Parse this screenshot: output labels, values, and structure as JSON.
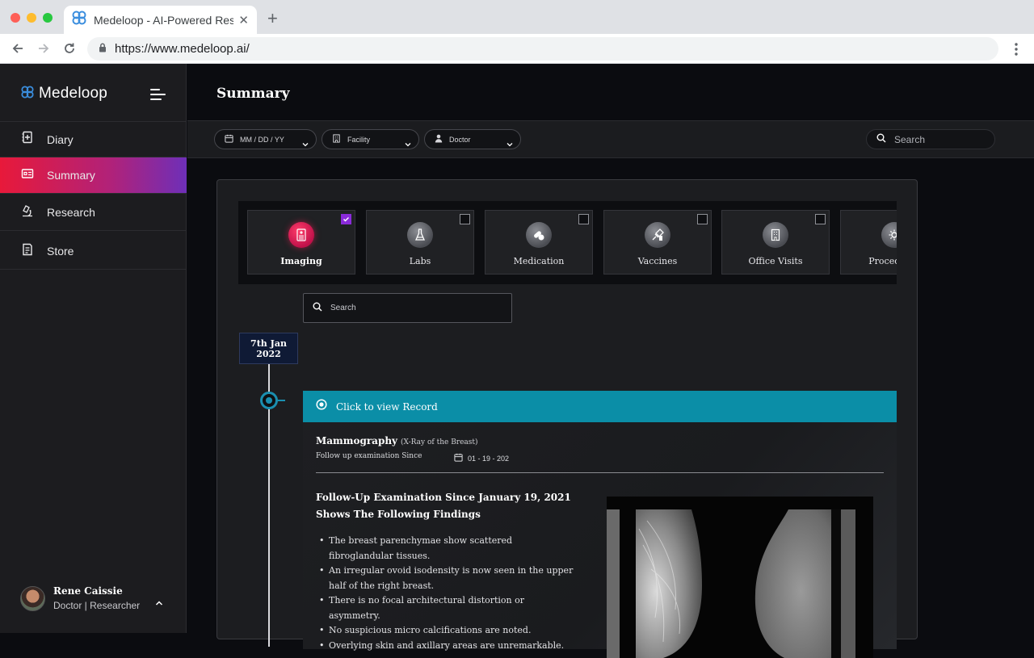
{
  "browser": {
    "tab_title": "Medeloop - AI-Powered Research",
    "url": "https://www.medeloop.ai/"
  },
  "app": {
    "logo_text": "Medeloop",
    "colors": {
      "accent_red": "#e8193a",
      "accent_purple": "#6e2fb8",
      "record_teal": "#0b8ea7",
      "checkbox_purple": "#8a2bd9"
    }
  },
  "sidebar": {
    "items": [
      {
        "label": "Diary",
        "icon": "diary-icon"
      },
      {
        "label": "Summary",
        "icon": "summary-icon",
        "active": true
      },
      {
        "label": "Research",
        "icon": "microscope-icon"
      },
      {
        "label": "Store",
        "icon": "store-icon"
      }
    ],
    "user": {
      "name": "Rene Caissie",
      "role": "Doctor | Researcher"
    }
  },
  "header": {
    "title": "Summary"
  },
  "filters": {
    "date_placeholder": "MM / DD / YY",
    "facility": "Facility",
    "doctor": "Doctor",
    "search_placeholder": "Search"
  },
  "categories": [
    {
      "label": "Imaging",
      "icon": "imaging-icon",
      "checked": true
    },
    {
      "label": "Labs",
      "icon": "flask-icon",
      "checked": false
    },
    {
      "label": "Medication",
      "icon": "pill-icon",
      "checked": false
    },
    {
      "label": "Vaccines",
      "icon": "vaccine-icon",
      "checked": false
    },
    {
      "label": "Office Visits",
      "icon": "building-icon",
      "checked": false
    },
    {
      "label": "Procedures",
      "icon": "procedures-icon",
      "checked": false
    }
  ],
  "record_search": {
    "placeholder": "Search"
  },
  "timeline": {
    "date_line1": "7th Jan",
    "date_line2": "2022"
  },
  "record": {
    "header_label": "Click to view Record",
    "exam_title": "Mammography",
    "exam_subtitle": "(X-Ray of the Breast)",
    "follow_up": "Follow up examination Since",
    "date": "01 - 19 - 202",
    "findings_heading_1": "Follow-Up Examination Since January 19, 2021",
    "findings_heading_2": "Shows The Following Findings",
    "findings": [
      "The breast parenchymae show scattered fibroglandular tissues.",
      "An irregular ovoid isodensity is now seen in the upper half of the right breast.",
      "There is no focal architectural distortion or asymmetry.",
      "No suspicious micro calcifications are noted.",
      "Overlying skin and axillary areas are unremarkable."
    ]
  }
}
